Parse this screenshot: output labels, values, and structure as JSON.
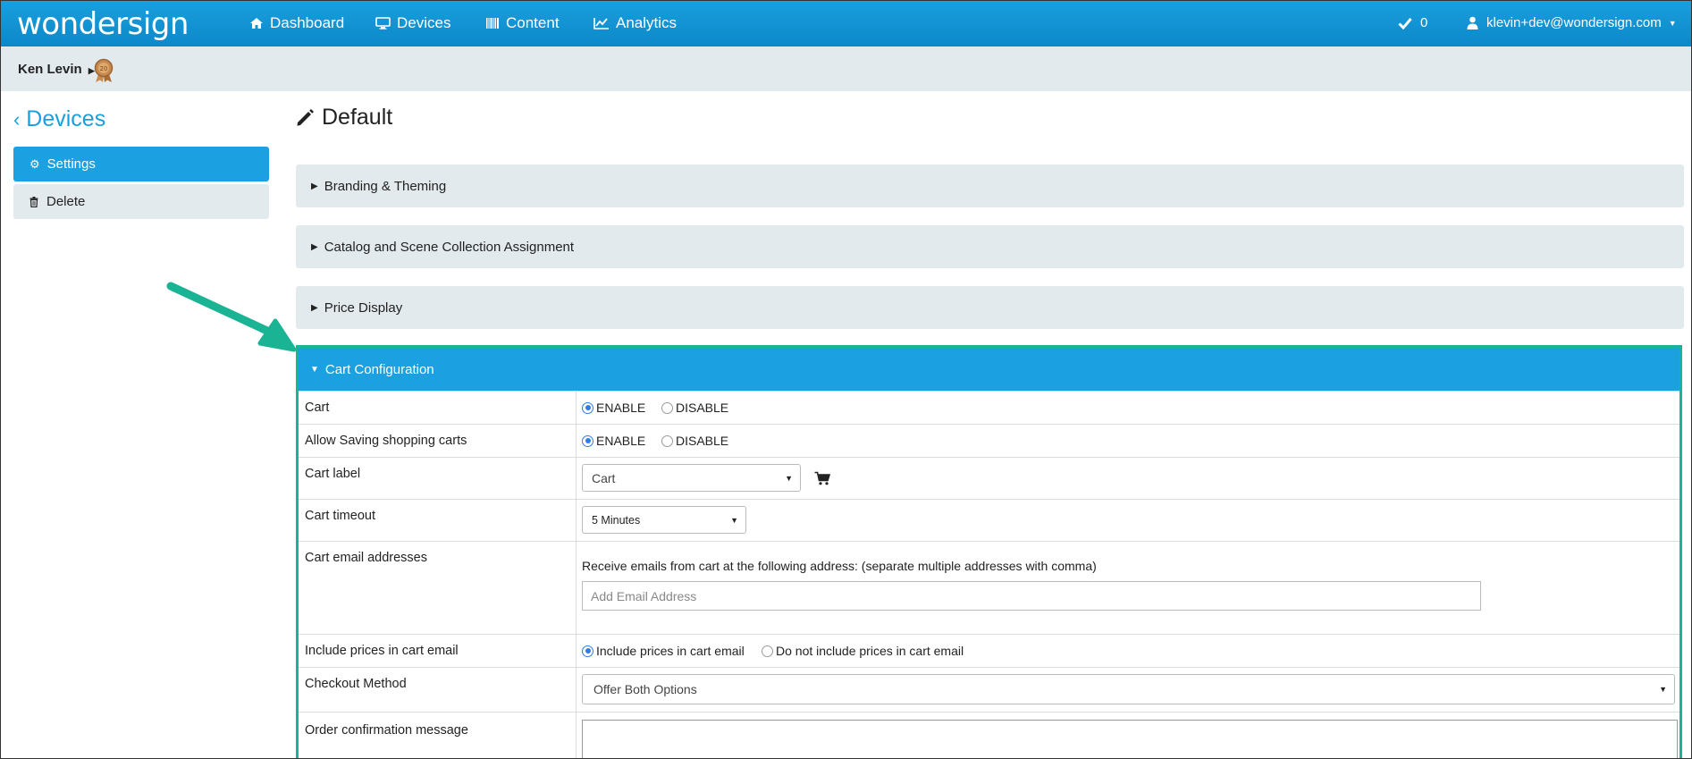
{
  "app": {
    "logo": "wondersign",
    "nav": [
      {
        "label": "Dashboard",
        "icon": "home-icon"
      },
      {
        "label": "Devices",
        "icon": "monitor-icon"
      },
      {
        "label": "Content",
        "icon": "barcode-icon"
      },
      {
        "label": "Analytics",
        "icon": "line-chart-icon"
      }
    ],
    "notifications_count": "0",
    "user_email": "klevin+dev@wondersign.com"
  },
  "subbar": {
    "user_name": "Ken Levin"
  },
  "sidebar": {
    "back_label": "Devices",
    "items": [
      {
        "label": "Settings",
        "icon": "gear-icon"
      },
      {
        "label": "Delete",
        "icon": "trash-icon"
      }
    ]
  },
  "main": {
    "title": "Default",
    "panels": [
      {
        "label": "Branding & Theming"
      },
      {
        "label": "Catalog and Scene Collection Assignment"
      },
      {
        "label": "Price Display"
      }
    ],
    "cart_config": {
      "title": "Cart Configuration",
      "rows": {
        "cart": {
          "label": "Cart",
          "enable": "ENABLE",
          "disable": "DISABLE",
          "selected": "ENABLE"
        },
        "saving": {
          "label": "Allow Saving shopping carts",
          "enable": "ENABLE",
          "disable": "DISABLE",
          "selected": "ENABLE"
        },
        "cart_label": {
          "label": "Cart label",
          "value": "Cart",
          "icon": "cart-icon"
        },
        "timeout": {
          "label": "Cart timeout",
          "value": "5 Minutes"
        },
        "emails": {
          "label": "Cart email addresses",
          "instruction": "Receive emails from cart at the following address: (separate multiple addresses with comma)",
          "placeholder": "Add Email Address"
        },
        "prices": {
          "label": "Include prices in cart email",
          "opt_include": "Include prices in cart email",
          "opt_exclude": "Do not include prices in cart email",
          "selected": "include"
        },
        "checkout": {
          "label": "Checkout Method",
          "value": "Offer Both Options"
        },
        "confirmation": {
          "label": "Order confirmation message"
        }
      }
    }
  },
  "colors": {
    "brand": "#1a9fdd",
    "highlight_border": "#1ab394",
    "panel_bg": "#e3eaed"
  }
}
